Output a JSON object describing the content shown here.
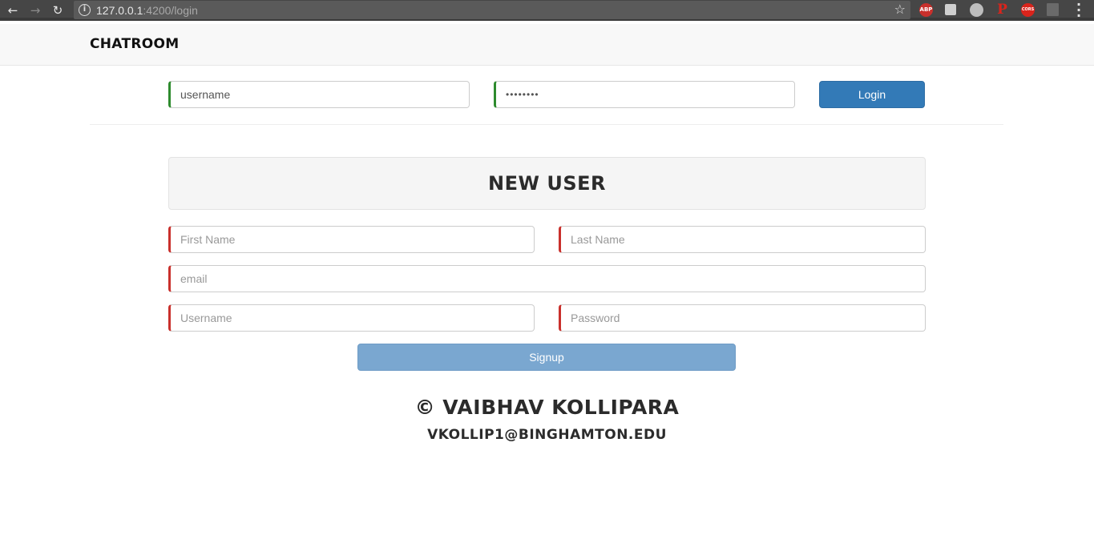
{
  "browser": {
    "back_icon": "arrow-left-icon",
    "forward_icon": "arrow-right-icon",
    "reload_icon": "reload-icon",
    "url_host": "127.0.0.1",
    "url_rest": ":4200/login",
    "extensions": [
      {
        "name": "adblock-icon",
        "label": "ABP",
        "color": "#c9302c"
      },
      {
        "name": "notes-icon",
        "label": "",
        "color": "#cfcfcf"
      },
      {
        "name": "cloud-icon",
        "label": "",
        "color": "#bdbdbd"
      },
      {
        "name": "pinterest-icon",
        "label": "P",
        "color": "#464646"
      },
      {
        "name": "cors-icon",
        "label": "CORS",
        "color": "#d9241c"
      },
      {
        "name": "film-icon",
        "label": "",
        "color": "#6a6a6a"
      }
    ]
  },
  "navbar": {
    "brand": "CHATROOM"
  },
  "login": {
    "username_value": "username",
    "password_value": "••••••••",
    "login_label": "Login"
  },
  "signup": {
    "title": "NEW USER",
    "first_name_placeholder": "First Name",
    "last_name_placeholder": "Last Name",
    "email_placeholder": "email",
    "username_placeholder": "Username",
    "password_placeholder": "Password",
    "signup_label": "Signup"
  },
  "footer": {
    "name": "© VAIBHAV KOLLIPARA",
    "email": "VKOLLIP1@BINGHAMTON.EDU"
  },
  "colors": {
    "valid_border": "#2e8b2e",
    "invalid_border": "#c9302c",
    "primary": "#337ab7"
  }
}
